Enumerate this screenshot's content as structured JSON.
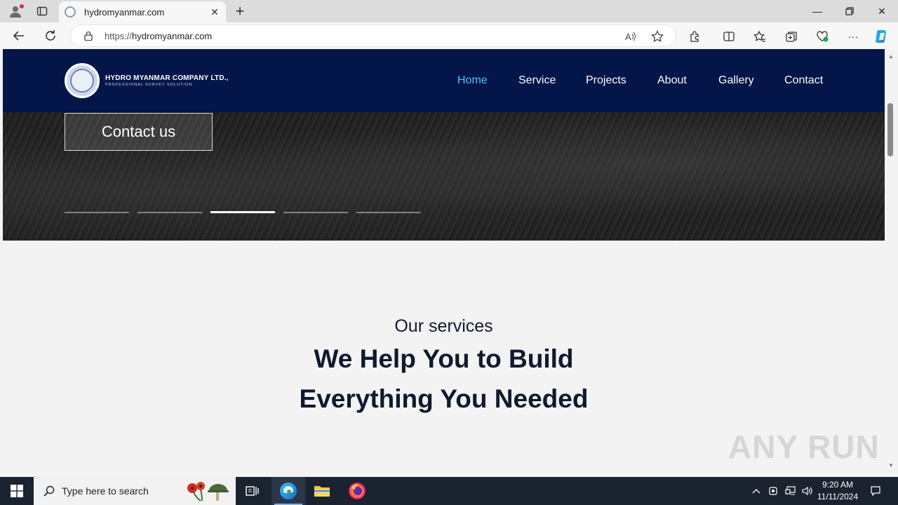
{
  "browser": {
    "tab_title": "hydromyanmar.com",
    "url_protocol": "https://",
    "url_host": "hydromyanmar.com",
    "icons": [
      "profile-icon",
      "tab-actions-icon",
      "close-icon",
      "new-tab-icon",
      "back-icon",
      "refresh-icon",
      "lock-icon",
      "read-aloud-icon",
      "favorite-star-icon",
      "extensions-icon",
      "split-screen-icon",
      "favorites-icon",
      "collections-icon",
      "browser-essentials-icon",
      "more-icon",
      "copilot-icon"
    ]
  },
  "site": {
    "logo_name": "HYDRO MYANMAR COMPANY LTD.,",
    "logo_subtitle": "PROFESSIONAL SURVEY SOLUTION",
    "menu": [
      {
        "label": "Home",
        "active": true
      },
      {
        "label": "Service",
        "active": false
      },
      {
        "label": "Projects",
        "active": false
      },
      {
        "label": "About",
        "active": false
      },
      {
        "label": "Gallery",
        "active": false
      },
      {
        "label": "Contact",
        "active": false
      }
    ],
    "hero": {
      "cta_label": "Contact us",
      "slide_count": 5,
      "active_slide": 3
    },
    "services": {
      "kicker": "Our services",
      "title_line1": "We Help You to Build",
      "title_line2": "Everything You Needed"
    },
    "colors": {
      "header_bg": "#031549",
      "menu_active": "#4cc3ff",
      "heading": "#0f1930"
    }
  },
  "watermark": "ANY RUN",
  "taskbar": {
    "search_placeholder": "Type here to search",
    "time": "9:20 AM",
    "date": "11/11/2024"
  }
}
